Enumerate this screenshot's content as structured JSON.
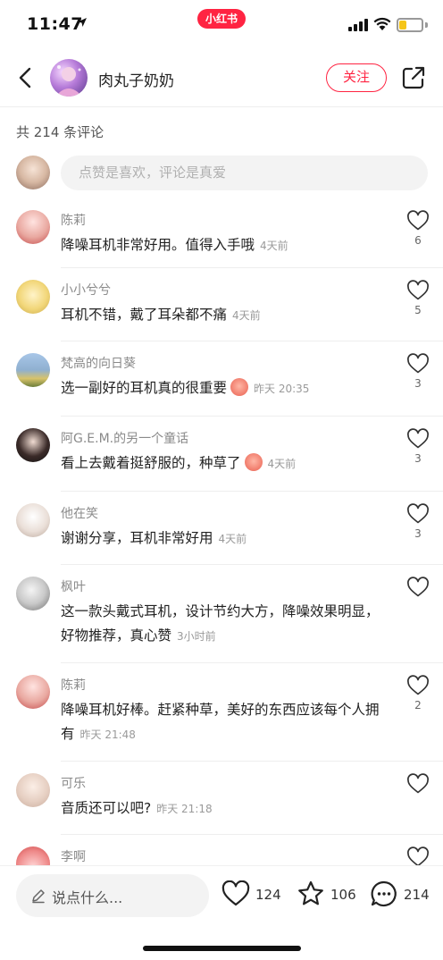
{
  "status_bar": {
    "time": "11:47",
    "app_badge": "小红书",
    "battery_level": 0.35,
    "colors": {
      "badge": "#ff2442",
      "battery": "#f5c518"
    }
  },
  "header": {
    "author_name": "肉丸子奶奶",
    "follow_label": "关注",
    "icons": {
      "back": "chevron-left-icon",
      "share": "share-out-icon"
    }
  },
  "comments_section": {
    "count_text": "共 214 条评论",
    "input_placeholder": "点赞是喜欢，评论是真爱",
    "items": [
      {
        "author": "陈莉",
        "text": "降噪耳机非常好用。值得入手哦",
        "time": "4天前",
        "likes": "6"
      },
      {
        "author": "小小兮兮",
        "text": "耳机不错，戴了耳朵都不痛",
        "time": "4天前",
        "likes": "5"
      },
      {
        "author": "梵高的向日葵",
        "text": "选一副好的耳机真的很重要",
        "emoji": true,
        "time": "昨天 20:35",
        "likes": "3"
      },
      {
        "author": "阿G.E.M.的另一个童话",
        "text": "看上去戴着挺舒服的，种草了",
        "emoji": true,
        "time": "4天前",
        "likes": "3"
      },
      {
        "author": "他在笑",
        "text": "谢谢分享，耳机非常好用",
        "time": "4天前",
        "likes": "3"
      },
      {
        "author": "枫叶",
        "text": "这一款头戴式耳机，设计节约大方，降噪效果明显，好物推荐，真心赞",
        "time": "3小时前",
        "likes": ""
      },
      {
        "author": "陈莉",
        "text": "降噪耳机好棒。赶紧种草，美好的东西应该每个人拥有",
        "time": "昨天 21:48",
        "likes": "2"
      },
      {
        "author": "可乐",
        "text": "音质还可以吧?",
        "time": "昨天 21:18",
        "likes": ""
      },
      {
        "author": "李啊",
        "text": "",
        "time": "",
        "likes": ""
      }
    ]
  },
  "bottom_bar": {
    "input_placeholder": "说点什么...",
    "like_count": "124",
    "favorite_count": "106",
    "comment_count": "214",
    "icons": {
      "input": "pencil-icon",
      "like": "heart-icon",
      "favorite": "star-icon",
      "comment": "chat-bubble-icon"
    }
  },
  "colors": {
    "accent": "#ff2442",
    "muted_text": "#8a8a8a",
    "input_bg": "#f3f3f3"
  }
}
